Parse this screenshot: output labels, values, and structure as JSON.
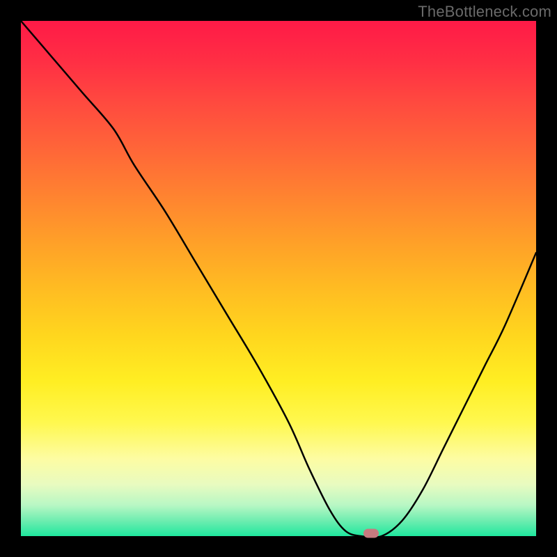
{
  "watermark": "TheBottleneck.com",
  "colors": {
    "curve": "#000000",
    "marker": "#c67a7f",
    "frame": "#000000"
  },
  "chart_data": {
    "type": "line",
    "title": "",
    "xlabel": "",
    "ylabel": "",
    "xlim": [
      0,
      100
    ],
    "ylim": [
      0,
      100
    ],
    "series": [
      {
        "name": "bottleneck-curve",
        "x": [
          0,
          6,
          12,
          18,
          22,
          28,
          34,
          40,
          46,
          52,
          56,
          60,
          63,
          66,
          70,
          74,
          78,
          82,
          86,
          90,
          94,
          100
        ],
        "y": [
          100,
          93,
          86,
          79,
          72,
          63,
          53,
          43,
          33,
          22,
          13,
          5,
          1,
          0,
          0,
          3,
          9,
          17,
          25,
          33,
          41,
          55
        ]
      }
    ],
    "marker": {
      "x": 68,
      "y": 0.5
    },
    "grid": false,
    "legend_position": "none"
  }
}
